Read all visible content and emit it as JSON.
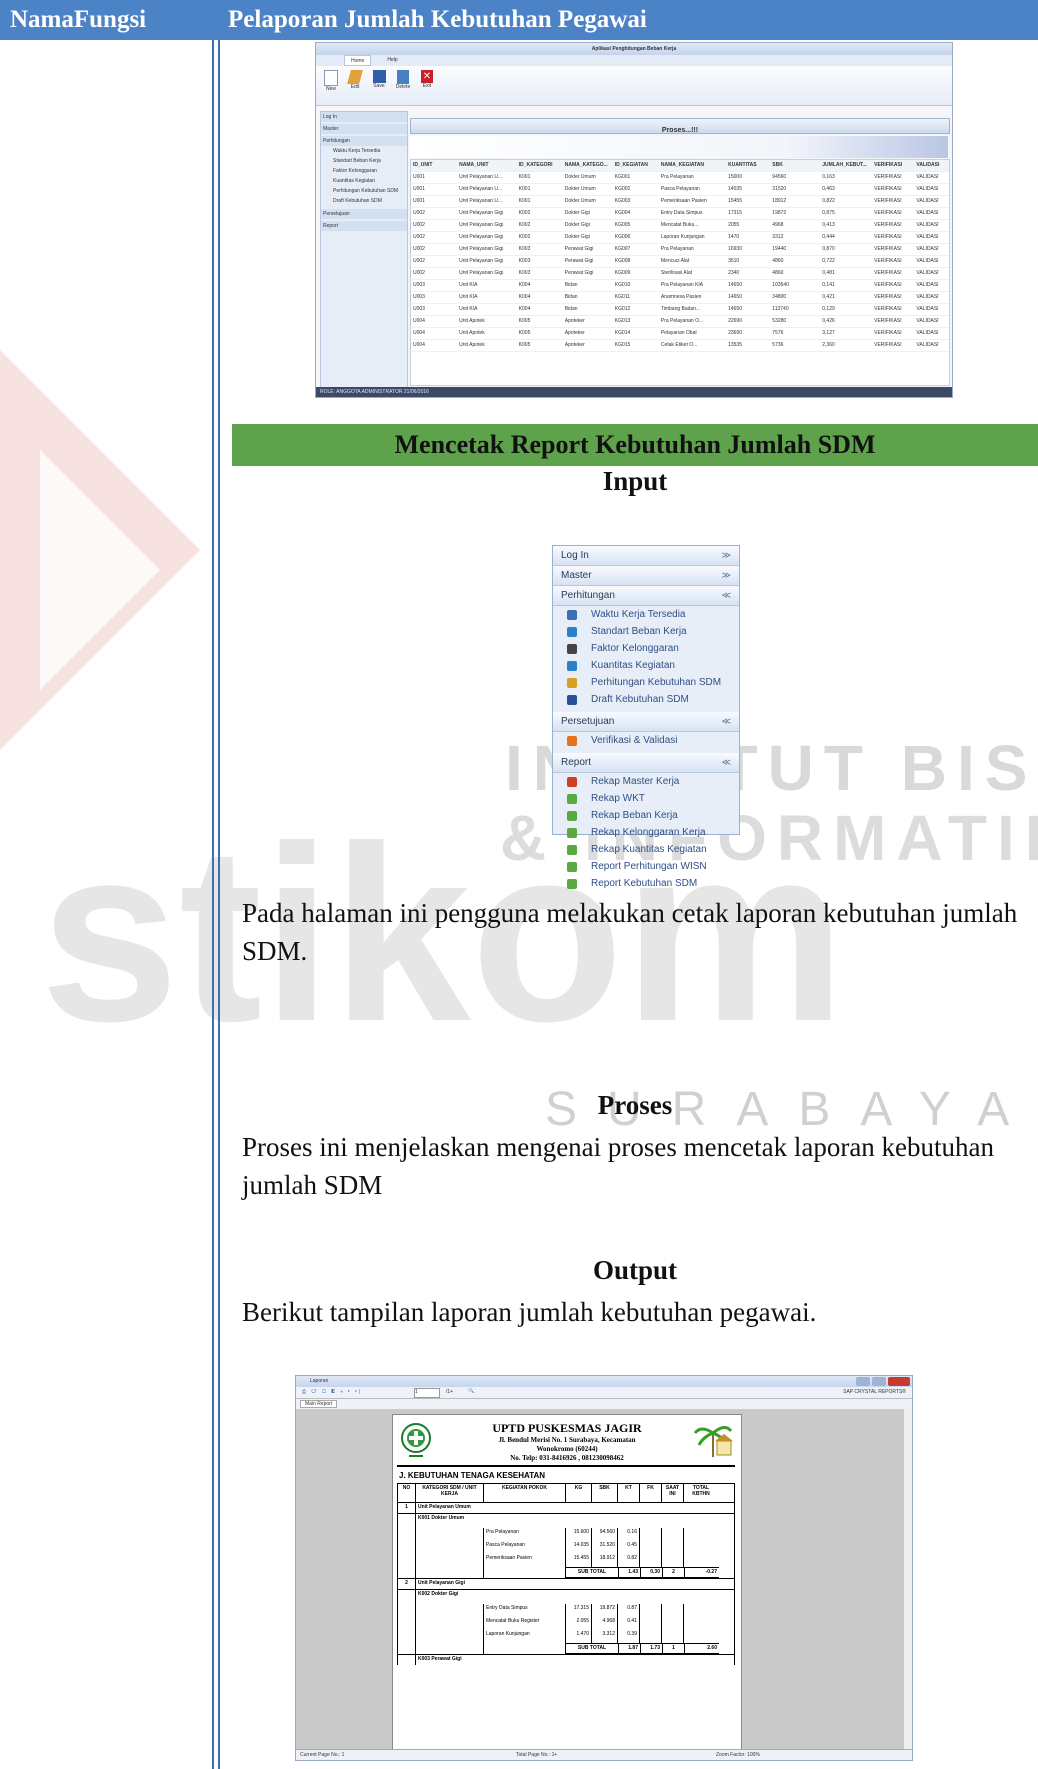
{
  "header": {
    "col1": "NamaFungsi",
    "col2": "Pelaporan Jumlah Kebutuhan Pegawai"
  },
  "app_screenshot": {
    "title": "Aplikasi Penghitungan Beban Kerja",
    "ribbon_tabs": [
      "Home",
      "Help"
    ],
    "ribbon_buttons": [
      "New",
      "Edit",
      "Save",
      "Delete",
      "Exit"
    ],
    "nav_items": [
      "Log In",
      "Master",
      "Perhitungan",
      "Waktu Kerja Tersedia",
      "Standart Beban Kerja",
      "Faktor Kelonggaran",
      "Kuantitas Kegiatan",
      "Perhitungan Kebutuhan SDM",
      "Draft Kebutuhan SDM",
      "Persetujuan",
      "Report"
    ],
    "panel_title": "Proses...!!!",
    "grid_headers": [
      "ID_UNIT",
      "NAMA_UNIT",
      "ID_KATEGORI",
      "NAMA_KATEGO...",
      "ID_KEGIATAN",
      "NAMA_KEGIATAN",
      "KUANTITAS",
      "SBK",
      "JUMLAH_KEBUT...",
      "VERIFIKASI",
      "VALIDASI"
    ],
    "grid_rows": [
      [
        "U001",
        "Unit Pelayanan U...",
        "K001",
        "Dokter Umum",
        "KG001",
        "Pra Pelayanan",
        "15000",
        "94560",
        "0,163",
        "VERIFIKASI",
        "VALIDASI"
      ],
      [
        "U001",
        "Unit Pelayanan U...",
        "K001",
        "Dokter Umum",
        "KG002",
        "Pasca Pelayanan",
        "14035",
        "31520",
        "0,463",
        "VERIFIKASI",
        "VALIDASI"
      ],
      [
        "U001",
        "Unit Pelayanan U...",
        "K001",
        "Dokter Umum",
        "KG003",
        "Pemeriksaan Pasien",
        "15455",
        "18912",
        "0,822",
        "VERIFIKASI",
        "VALIDASI"
      ],
      [
        "U002",
        "Unit Pelayanan Gigi",
        "K002",
        "Dokter Gigi",
        "KG004",
        "Entry Data Simpus",
        "17315",
        "19872",
        "0,875",
        "VERIFIKASI",
        "VALIDASI"
      ],
      [
        "U002",
        "Unit Pelayanan Gigi",
        "K002",
        "Dokter Gigi",
        "KG005",
        "Mencatat Buku...",
        "2055",
        "4968",
        "0,413",
        "VERIFIKASI",
        "VALIDASI"
      ],
      [
        "U002",
        "Unit Pelayanan Gigi",
        "K002",
        "Dokter Gigi",
        "KG006",
        "Laporan Kunjungan",
        "1470",
        "3312",
        "0,444",
        "VERIFIKASI",
        "VALIDASI"
      ],
      [
        "U002",
        "Unit Pelayanan Gigi",
        "K003",
        "Perawat Gigi",
        "KG007",
        "Pra Pelayanan",
        "16930",
        "19440",
        "0,870",
        "VERIFIKASI",
        "VALIDASI"
      ],
      [
        "U002",
        "Unit Pelayanan Gigi",
        "K003",
        "Perawat Gigi",
        "KG008",
        "Mencuci Alat",
        "3510",
        "4860",
        "0,722",
        "VERIFIKASI",
        "VALIDASI"
      ],
      [
        "U002",
        "Unit Pelayanan Gigi",
        "K003",
        "Perawat Gigi",
        "KG009",
        "Sterilisasi Alat",
        "2340",
        "4860",
        "0,481",
        "VERIFIKASI",
        "VALIDASI"
      ],
      [
        "U003",
        "Unit KIA",
        "K004",
        "Bidan",
        "KG010",
        "Pra Pelayanan KIA",
        "14650",
        "103540",
        "0,141",
        "VERIFIKASI",
        "VALIDASI"
      ],
      [
        "U003",
        "Unit KIA",
        "K004",
        "Bidan",
        "KG011",
        "Anamnesa Pasien",
        "14650",
        "34800",
        "0,421",
        "VERIFIKASI",
        "VALIDASI"
      ],
      [
        "U003",
        "Unit KIA",
        "K004",
        "Bidan",
        "KG012",
        "Timbang Badan...",
        "14650",
        "113740",
        "0,129",
        "VERIFIKASI",
        "VALIDASI"
      ],
      [
        "U004",
        "Unit Apotek",
        "K005",
        "Apoteker",
        "KG013",
        "Pra Pelayanan O...",
        "22690",
        "53280",
        "0,426",
        "VERIFIKASI",
        "VALIDASI"
      ],
      [
        "U004",
        "Unit Apotek",
        "K005",
        "Apoteker",
        "KG014",
        "Pelayanan Obat",
        "23690",
        "7576",
        "3,127",
        "VERIFIKASI",
        "VALIDASI"
      ],
      [
        "U004",
        "Unit Apotek",
        "K005",
        "Apoteker",
        "KG015",
        "Cetak Etiket O...",
        "13535",
        "5736",
        "2,360",
        "VERIFIKASI",
        "VALIDASI"
      ]
    ],
    "status_bar": "ROLE: ANGGOTA ADMINISTRATOR 21/06/2016"
  },
  "section": {
    "bar_title": "Mencetak Report Kebutuhan Jumlah SDM",
    "input_heading": "Input",
    "input_text": "Pada halaman ini pengguna melakukan cetak laporan kebutuhan jumlah SDM.",
    "proses_heading": "Proses",
    "proses_text": "Proses ini menjelaskan mengenai proses mencetak laporan kebutuhan jumlah SDM",
    "output_heading": "Output",
    "output_text": "Berikut tampilan laporan jumlah kebutuhan pegawai."
  },
  "menu": {
    "groups": [
      {
        "label": "Log In",
        "chevron": "≫",
        "items": []
      },
      {
        "label": "Master",
        "chevron": "≫",
        "items": []
      },
      {
        "label": "Perhitungan",
        "chevron": "≪",
        "items": [
          "Waktu Kerja Tersedia",
          "Standart Beban Kerja",
          "Faktor Kelonggaran",
          "Kuantitas Kegiatan",
          "Perhitungan Kebutuhan SDM",
          "Draft Kebutuhan SDM"
        ]
      },
      {
        "label": "Persetujuan",
        "chevron": "≪",
        "items": [
          "Verifikasi & Validasi"
        ]
      },
      {
        "label": "Report",
        "chevron": "≪",
        "items": [
          "Rekap Master Kerja",
          "Rekap WKT",
          "Rekap Beban Kerja",
          "Rekap Kelonggaran Kerja",
          "Rekap Kuantitas Kegiatan",
          "Report Perhitungan WISN",
          "Report Kebutuhan SDM"
        ]
      }
    ],
    "item_colors": [
      "#3d6fb8",
      "#2a80c9",
      "#444444",
      "#2a80c9",
      "#d9a020",
      "#2a4f9a",
      "#e8711a",
      "#d04020",
      "#5aa840",
      "#5aa840",
      "#5aa840",
      "#5aa840",
      "#5aa840",
      "#5aa840",
      "#5aa840"
    ]
  },
  "watermark": {
    "line1": "INSTITUT BISNIS",
    "line2": "& INFORMATIKA",
    "logo": "stikom",
    "line3": "SURABAYA",
    "color": "#c8c8c8",
    "accent": "#e04040"
  },
  "report": {
    "window_title": "Laporan",
    "tab": "Main Report",
    "brand": "SAP CRYSTAL REPORTS®",
    "org_name": "UPTD PUSKESMAS JAGIR",
    "address1": "Jl. Bendul Merisi No. 1 Surabaya, Kecamatan",
    "address2": "Wonokromo (60244)",
    "phone": "No. Telp: 031-8416926 , 081230098462",
    "section_title": "J. KEBUTUHAN TENAGA KESEHATAN",
    "columns": [
      "NO",
      "KATEGORI SDM / UNIT KERJA",
      "KEGIATAN POKOK",
      "KG",
      "SBK",
      "KT",
      "FK",
      "SAAT INI",
      "TOTAL KBTHN"
    ],
    "groups": [
      {
        "no": "1",
        "unit": "Unit Pelayanan Umum",
        "category": "K001  Dokter Umum",
        "rows": [
          [
            "Pra Pelayanan",
            "15.600",
            "94.560",
            "0.16"
          ],
          [
            "Pasca Pelayanan",
            "14.035",
            "31.520",
            "0.45"
          ],
          [
            "Pemeriksaan Pasien",
            "15.455",
            "18.912",
            "0.82"
          ]
        ],
        "subtotal": [
          "SUB TOTAL",
          "1.43",
          "0.30",
          "2",
          "-0.27"
        ]
      },
      {
        "no": "2",
        "unit": "Unit Pelayanan Gigi",
        "category": "K002  Dokter Gigi",
        "rows": [
          [
            "Entry Data Simpus",
            "17.315",
            "19.872",
            "0.87"
          ],
          [
            "Mencatat Buku Register",
            "2.055",
            "4.968",
            "0.41"
          ],
          [
            "Laporan Kunjungan",
            "1.470",
            "3.312",
            "0.39"
          ]
        ],
        "subtotal": [
          "SUB TOTAL",
          "1.87",
          "1.73",
          "1",
          "2.60"
        ]
      }
    ],
    "next_category": "K003  Perawat Gigi",
    "status_left": "Current Page No.: 1",
    "status_mid": "Total Page No.: 1+",
    "status_right": "Zoom Factor: 100%",
    "page_field": "1",
    "page_of": "/1+"
  }
}
